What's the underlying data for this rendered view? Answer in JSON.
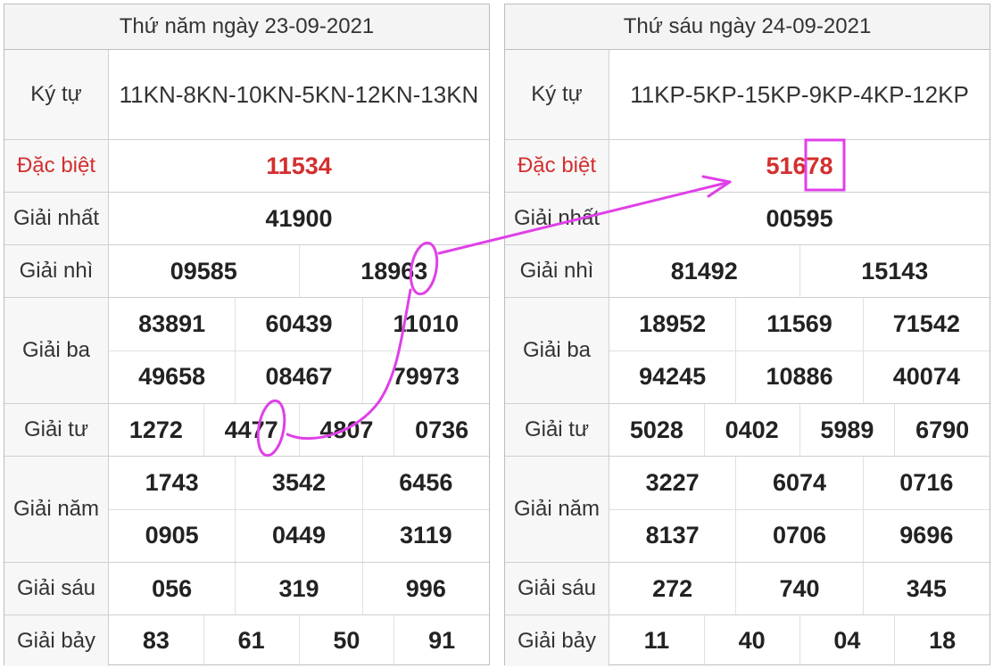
{
  "left": {
    "title": "Thứ năm ngày 23-09-2021",
    "labels": {
      "kytu": "Ký tự",
      "db": "Đặc biệt",
      "nhat": "Giải nhất",
      "nhi": "Giải nhì",
      "ba": "Giải ba",
      "tu": "Giải tư",
      "nam": "Giải năm",
      "sau": "Giải sáu",
      "bay": "Giải bảy"
    },
    "kytu": "11KN-8KN-10KN-5KN-12KN-13KN",
    "dac_biet": "11534",
    "nhat": "41900",
    "nhi": [
      "09585",
      "18963"
    ],
    "ba": [
      "83891",
      "60439",
      "11010",
      "49658",
      "08467",
      "79973"
    ],
    "tu": [
      "1272",
      "4477",
      "4807",
      "0736"
    ],
    "nam": [
      "1743",
      "3542",
      "6456",
      "0905",
      "0449",
      "3119"
    ],
    "sau": [
      "056",
      "319",
      "996"
    ],
    "bay": [
      "83",
      "61",
      "50",
      "91"
    ]
  },
  "right": {
    "title": "Thứ sáu ngày 24-09-2021",
    "labels": {
      "kytu": "Ký tự",
      "db": "Đặc biệt",
      "nhat": "Giải nhất",
      "nhi": "Giải nhì",
      "ba": "Giải ba",
      "tu": "Giải tư",
      "nam": "Giải năm",
      "sau": "Giải sáu",
      "bay": "Giải bảy"
    },
    "kytu": "11KP-5KP-15KP-9KP-4KP-12KP",
    "dac_biet": "51678",
    "nhat": "00595",
    "nhi": [
      "81492",
      "15143"
    ],
    "ba": [
      "18952",
      "11569",
      "71542",
      "94245",
      "10886",
      "40074"
    ],
    "tu": [
      "5028",
      "0402",
      "5989",
      "6790"
    ],
    "nam": [
      "3227",
      "6074",
      "0716",
      "8137",
      "0706",
      "9696"
    ],
    "sau": [
      "272",
      "740",
      "345"
    ],
    "bay": [
      "11",
      "40",
      "04",
      "18"
    ]
  },
  "colors": {
    "special": "#d32f2f",
    "annotation": "#e040e8"
  }
}
